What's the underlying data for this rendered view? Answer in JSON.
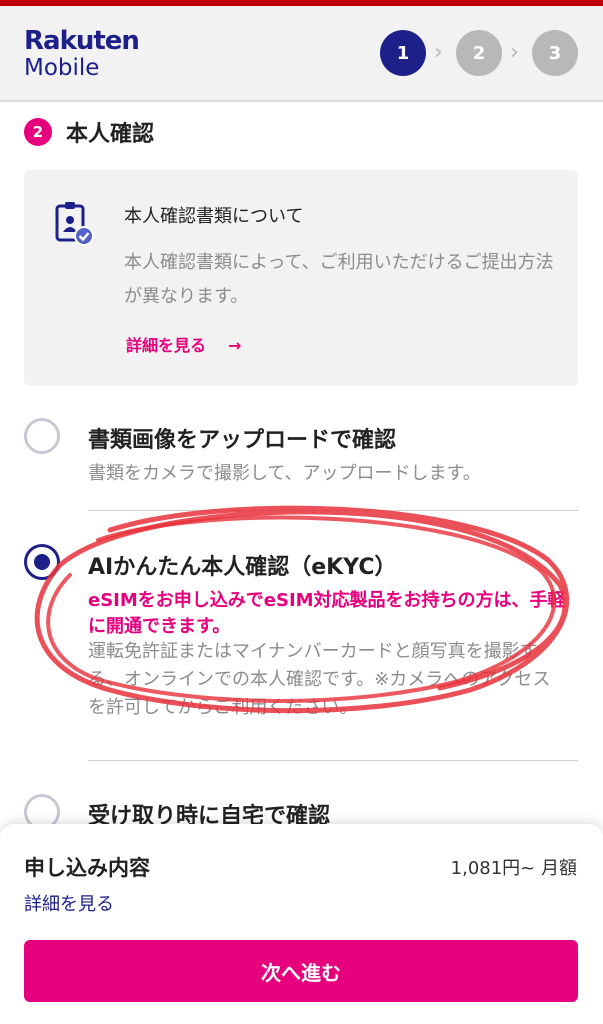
{
  "brand": {
    "line1": "Rakuten",
    "line2": "Mobile"
  },
  "steps": [
    {
      "label": "1",
      "active": true
    },
    {
      "label": "2",
      "active": false
    },
    {
      "label": "3",
      "active": false
    }
  ],
  "section": {
    "number": "2",
    "title": "本人確認"
  },
  "info_card": {
    "icon": "id-document-check-icon",
    "title": "本人確認書類について",
    "body": "本人確認書類によって、ご利用いただけるご提出方法が異なります。",
    "link_label": "詳細を見る",
    "link_arrow": "→"
  },
  "options": [
    {
      "title": "書類画像をアップロードで確認",
      "description": "書類をカメラで撮影して、アップロードします。",
      "selected": false
    },
    {
      "title": "AIかんたん本人確認（eKYC）",
      "highlight": "eSIMをお申し込みでeSIM対応製品をお持ちの方は、手軽に開通できます。",
      "description": "運転免許証またはマイナンバーカードと顔写真を撮影する、オンラインでの本人確認です。※カメラへのアクセスを許可してからご利用ください。",
      "selected": true
    },
    {
      "title": "受け取り時に自宅で確認",
      "selected": false
    }
  ],
  "summary": {
    "title": "申し込み内容",
    "price": "1,081円~ 月額",
    "detail_link": "詳細を見る",
    "next_button": "次へ進む"
  },
  "colors": {
    "brand_red": "#bf0000",
    "accent_pink": "#e6007e",
    "navy": "#1d2088",
    "inactive_step": "#b8b8b8",
    "annotation_red": "#e8303a"
  }
}
